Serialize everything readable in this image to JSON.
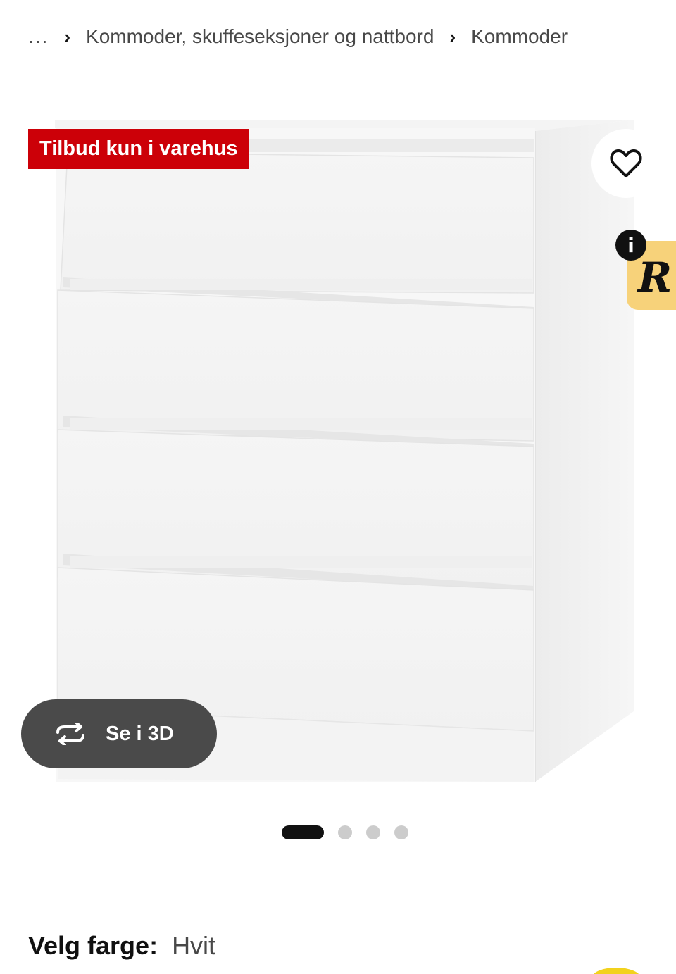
{
  "breadcrumb": {
    "ellipsis": "...",
    "separator": "›",
    "items": [
      {
        "label": "Kommoder, skuffeseksjoner og nattbord"
      },
      {
        "label": "Kommoder"
      }
    ]
  },
  "product_image": {
    "badge": "Tilbud kun i varehus",
    "view_3d_label": "Se i 3D",
    "info_icon_label": "i",
    "ad_tab_letter": "R",
    "carousel": {
      "current_index": 1,
      "total": 4
    }
  },
  "color_selection": {
    "label": "Velg farge:",
    "value": "Hvit"
  },
  "colors": {
    "badge_red": "#cc0008",
    "pill_gray": "#4a4a4a",
    "ad_yellow": "#f7d27a",
    "swatch_yellow": "#f2d21d"
  },
  "icons": {
    "favorite": "heart-icon",
    "view_3d": "rotate-3d-icon",
    "info": "info-icon"
  }
}
